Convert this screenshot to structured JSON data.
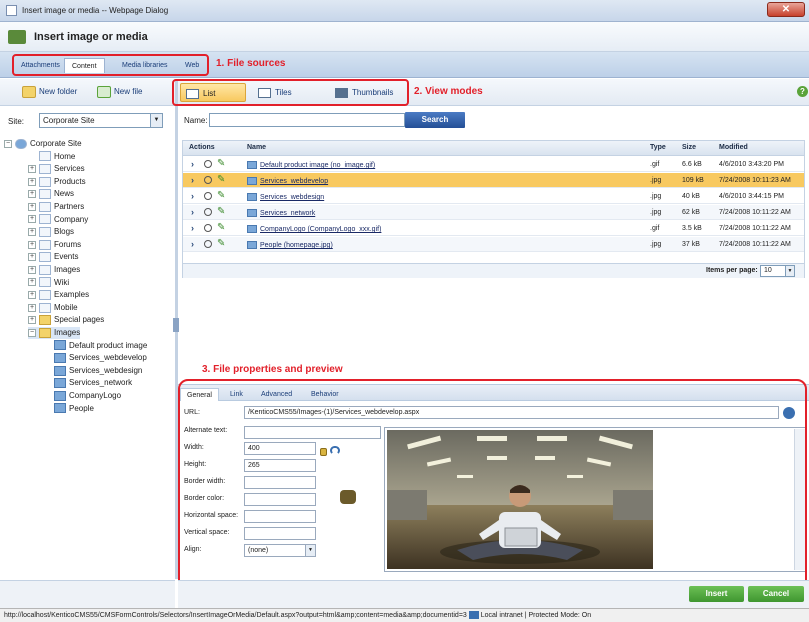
{
  "window": {
    "title": "Insert image or media -- Webpage Dialog",
    "close_glyph": "✕"
  },
  "header": {
    "title": "Insert image or media"
  },
  "sources": {
    "tabs": [
      "Attachments",
      "Content",
      "Media libraries",
      "Web"
    ],
    "active": "Content"
  },
  "callouts": {
    "file_sources": "1. File sources",
    "view_modes": "2. View modes",
    "properties": "3. File properties and preview"
  },
  "left_toolbar": {
    "new_folder": "New folder",
    "new_file": "New file"
  },
  "site": {
    "label": "Site:",
    "value": "Corporate Site"
  },
  "tree": {
    "root": "Corporate Site",
    "items": [
      {
        "label": "Home",
        "expander": ""
      },
      {
        "label": "Services",
        "expander": "+"
      },
      {
        "label": "Products",
        "expander": "+"
      },
      {
        "label": "News",
        "expander": "+"
      },
      {
        "label": "Partners",
        "expander": "+"
      },
      {
        "label": "Company",
        "expander": "+"
      },
      {
        "label": "Blogs",
        "expander": "+"
      },
      {
        "label": "Forums",
        "expander": "+"
      },
      {
        "label": "Events",
        "expander": "+"
      },
      {
        "label": "Images",
        "expander": "+"
      },
      {
        "label": "Wiki",
        "expander": "+"
      },
      {
        "label": "Examples",
        "expander": "+"
      },
      {
        "label": "Mobile",
        "expander": "+"
      },
      {
        "label": "Special pages",
        "expander": "+"
      },
      {
        "label": "Images",
        "expander": "-"
      }
    ],
    "children": [
      "Default product image",
      "Services_webdevelop",
      "Services_webdesign",
      "Services_network",
      "CompanyLogo",
      "People"
    ]
  },
  "view_modes": {
    "list": "List",
    "tiles": "Tiles",
    "thumbnails": "Thumbnails",
    "active": "List"
  },
  "search": {
    "label": "Name:",
    "button": "Search",
    "value": ""
  },
  "grid": {
    "headers": {
      "actions": "Actions",
      "name": "Name",
      "type": "Type",
      "size": "Size",
      "modified": "Modified"
    },
    "rows": [
      {
        "name": "Default product image (no_image.gif)",
        "type": ".gif",
        "size": "6.6 kB",
        "modified": "4/6/2010 3:43:20 PM"
      },
      {
        "name": "Services_webdevelop",
        "type": ".jpg",
        "size": "109 kB",
        "modified": "7/24/2008 10:11:23 AM"
      },
      {
        "name": "Services_webdesign",
        "type": ".jpg",
        "size": "40 kB",
        "modified": "4/6/2010 3:44:15 PM"
      },
      {
        "name": "Services_network",
        "type": ".jpg",
        "size": "62 kB",
        "modified": "7/24/2008 10:11:22 AM"
      },
      {
        "name": "CompanyLogo (CompanyLogo_xxx.gif)",
        "type": ".gif",
        "size": "3.5 kB",
        "modified": "7/24/2008 10:11:22 AM"
      },
      {
        "name": "People (homepage.jpg)",
        "type": ".jpg",
        "size": "37 kB",
        "modified": "7/24/2008 10:11:22 AM"
      }
    ],
    "selected_row": 1,
    "items_per_page_label": "Items per page:",
    "items_per_page": "10"
  },
  "properties": {
    "tabs": [
      "General",
      "Link",
      "Advanced",
      "Behavior"
    ],
    "active_tab": "General",
    "url_label": "URL:",
    "url": "/KenticoCMS55/Images-(1)/Services_webdevelop.aspx",
    "alt_label": "Alternate text:",
    "alt": "",
    "width_label": "Width:",
    "width": "400",
    "height_label": "Height:",
    "height": "265",
    "border_width_label": "Border width:",
    "border_color_label": "Border color:",
    "hspace_label": "Horizontal space:",
    "vspace_label": "Vertical space:",
    "align_label": "Align:",
    "align": "(none)"
  },
  "footer": {
    "insert": "Insert",
    "cancel": "Cancel"
  },
  "status": {
    "url": "http://localhost/KenticoCMS55/CMSFormControls/Selectors/InsertImageOrMedia/Default.aspx?output=html&amp;content=media&amp;documentid=3",
    "zone": "Local intranet | Protected Mode: On"
  },
  "colors": {
    "callout": "#e2202a",
    "accent": "#f8c960",
    "action_green": "#3f9630"
  }
}
